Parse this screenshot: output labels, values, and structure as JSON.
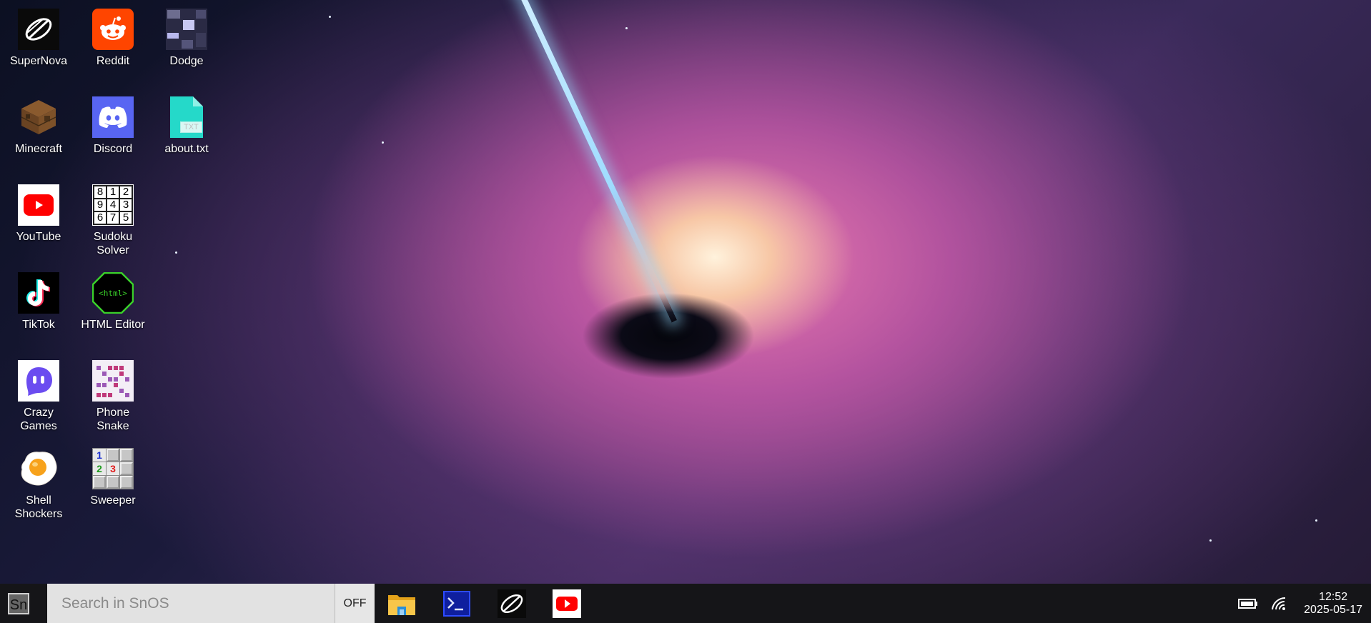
{
  "desktop": {
    "icons": [
      {
        "label": "SuperNova",
        "icon": "supernova-icon"
      },
      {
        "label": "Reddit",
        "icon": "reddit-icon"
      },
      {
        "label": "Dodge",
        "icon": "dodge-icon"
      },
      {
        "label": "Minecraft",
        "icon": "minecraft-icon"
      },
      {
        "label": "Discord",
        "icon": "discord-icon"
      },
      {
        "label": "about.txt",
        "icon": "txt-file-icon",
        "badge": "TXT"
      },
      {
        "label": "YouTube",
        "icon": "youtube-icon"
      },
      {
        "label": "Sudoku\nSolver",
        "icon": "sudoku-icon",
        "digits": [
          "8",
          "1",
          "2",
          "9",
          "4",
          "3",
          "6",
          "7",
          "5"
        ]
      },
      {
        "label": "TikTok",
        "icon": "tiktok-icon"
      },
      {
        "label": "HTML Editor",
        "icon": "html-editor-icon",
        "badge": "<html>"
      },
      {
        "label": "Crazy\nGames",
        "icon": "crazy-games-icon"
      },
      {
        "label": "Phone\nSnake",
        "icon": "phone-snake-icon"
      },
      {
        "label": "Shell\nShockers",
        "icon": "shell-shockers-icon"
      },
      {
        "label": "Sweeper",
        "icon": "minesweeper-icon",
        "digits": [
          "1",
          "2",
          "3"
        ]
      }
    ]
  },
  "taskbar": {
    "start_label": "Sn",
    "search_placeholder": "Search in SnOS",
    "toggle_label": "OFF",
    "pinned": [
      "file-explorer-icon",
      "terminal-icon",
      "supernova-icon",
      "youtube-icon"
    ],
    "clock": {
      "time": "12:52",
      "date": "2025-05-17"
    }
  },
  "colors": {
    "taskbar_bg": "#151518",
    "search_bg": "#e2e2e2",
    "reddit": "#ff4500",
    "discord": "#5865f2",
    "youtube": "#ff0000",
    "txt_file": "#25d9c9",
    "html_editor": "#3ad12a",
    "crazy_games": "#6b4cf0"
  }
}
